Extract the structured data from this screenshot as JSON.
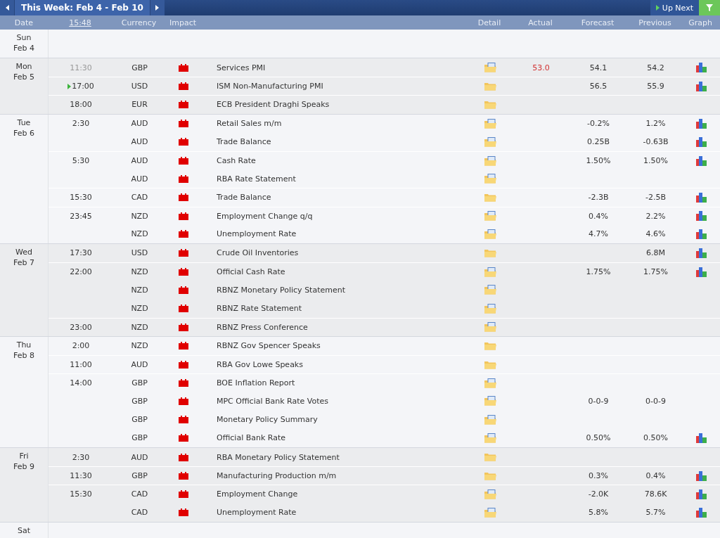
{
  "toolbar": {
    "title": "This Week: Feb 4 - Feb 10",
    "up_next": "Up Next"
  },
  "columns": {
    "date": "Date",
    "time": "15:48",
    "currency": "Currency",
    "impact": "Impact",
    "detail": "Detail",
    "actual": "Actual",
    "forecast": "Forecast",
    "previous": "Previous",
    "graph": "Graph"
  },
  "days": [
    {
      "day": "Sun",
      "date": "Feb 4"
    },
    {
      "day": "Mon",
      "date": "Feb 5",
      "events": [
        {
          "time": "11:30",
          "past": true,
          "next": false,
          "currency": "GBP",
          "title": "Services PMI",
          "has_document": true,
          "actual": "53.0",
          "actual_worse": true,
          "forecast": "54.1",
          "previous": "54.2",
          "graph": true
        },
        {
          "time": "17:00",
          "past": false,
          "next": true,
          "currency": "USD",
          "title": "ISM Non-Manufacturing PMI",
          "has_document": false,
          "forecast": "56.5",
          "previous": "55.9",
          "graph": true
        },
        {
          "time": "18:00",
          "past": false,
          "next": false,
          "currency": "EUR",
          "title": "ECB President Draghi Speaks",
          "has_document": false,
          "graph": false
        }
      ]
    },
    {
      "day": "Tue",
      "date": "Feb 6",
      "events": [
        {
          "time": "2:30",
          "past": false,
          "next": false,
          "currency": "AUD",
          "title": "Retail Sales m/m",
          "has_document": true,
          "forecast": "-0.2%",
          "previous": "1.2%",
          "graph": true
        },
        {
          "currency": "AUD",
          "title": "Trade Balance",
          "has_document": true,
          "forecast": "0.25B",
          "previous": "-0.63B",
          "graph": true
        },
        {
          "time": "5:30",
          "past": false,
          "next": false,
          "currency": "AUD",
          "title": "Cash Rate",
          "has_document": true,
          "forecast": "1.50%",
          "previous": "1.50%",
          "graph": true
        },
        {
          "currency": "AUD",
          "title": "RBA Rate Statement",
          "has_document": true,
          "graph": false
        },
        {
          "time": "15:30",
          "past": false,
          "next": false,
          "currency": "CAD",
          "title": "Trade Balance",
          "has_document": false,
          "forecast": "-2.3B",
          "previous": "-2.5B",
          "graph": true
        },
        {
          "time": "23:45",
          "past": false,
          "next": false,
          "currency": "NZD",
          "title": "Employment Change q/q",
          "has_document": true,
          "forecast": "0.4%",
          "previous": "2.2%",
          "graph": true
        },
        {
          "currency": "NZD",
          "title": "Unemployment Rate",
          "has_document": true,
          "forecast": "4.7%",
          "previous": "4.6%",
          "graph": true
        }
      ]
    },
    {
      "day": "Wed",
      "date": "Feb 7",
      "events": [
        {
          "time": "17:30",
          "past": false,
          "next": false,
          "currency": "USD",
          "title": "Crude Oil Inventories",
          "has_document": false,
          "previous": "6.8M",
          "graph": true
        },
        {
          "time": "22:00",
          "past": false,
          "next": false,
          "currency": "NZD",
          "title": "Official Cash Rate",
          "has_document": true,
          "forecast": "1.75%",
          "previous": "1.75%",
          "graph": true
        },
        {
          "currency": "NZD",
          "title": "RBNZ Monetary Policy Statement",
          "has_document": true,
          "graph": false
        },
        {
          "currency": "NZD",
          "title": "RBNZ Rate Statement",
          "has_document": true,
          "graph": false
        },
        {
          "time": "23:00",
          "past": false,
          "next": false,
          "currency": "NZD",
          "title": "RBNZ Press Conference",
          "has_document": true,
          "graph": false
        }
      ]
    },
    {
      "day": "Thu",
      "date": "Feb 8",
      "events": [
        {
          "time": "2:00",
          "past": false,
          "next": false,
          "currency": "NZD",
          "title": "RBNZ Gov Spencer Speaks",
          "has_document": false,
          "graph": false
        },
        {
          "time": "11:00",
          "past": false,
          "next": false,
          "currency": "AUD",
          "title": "RBA Gov Lowe Speaks",
          "has_document": false,
          "graph": false
        },
        {
          "time": "14:00",
          "past": false,
          "next": false,
          "currency": "GBP",
          "title": "BOE Inflation Report",
          "has_document": true,
          "graph": false
        },
        {
          "currency": "GBP",
          "title": "MPC Official Bank Rate Votes",
          "has_document": true,
          "forecast": "0-0-9",
          "previous": "0-0-9",
          "graph": false
        },
        {
          "currency": "GBP",
          "title": "Monetary Policy Summary",
          "has_document": true,
          "graph": false
        },
        {
          "currency": "GBP",
          "title": "Official Bank Rate",
          "has_document": true,
          "forecast": "0.50%",
          "previous": "0.50%",
          "graph": true
        }
      ]
    },
    {
      "day": "Fri",
      "date": "Feb 9",
      "events": [
        {
          "time": "2:30",
          "past": false,
          "next": false,
          "currency": "AUD",
          "title": "RBA Monetary Policy Statement",
          "has_document": false,
          "graph": false
        },
        {
          "time": "11:30",
          "past": false,
          "next": false,
          "currency": "GBP",
          "title": "Manufacturing Production m/m",
          "has_document": false,
          "forecast": "0.3%",
          "previous": "0.4%",
          "graph": true
        },
        {
          "time": "15:30",
          "past": false,
          "next": false,
          "currency": "CAD",
          "title": "Employment Change",
          "has_document": true,
          "forecast": "-2.0K",
          "previous": "78.6K",
          "graph": true
        },
        {
          "currency": "CAD",
          "title": "Unemployment Rate",
          "has_document": true,
          "forecast": "5.8%",
          "previous": "5.7%",
          "graph": true
        }
      ]
    },
    {
      "day": "Sat"
    }
  ]
}
